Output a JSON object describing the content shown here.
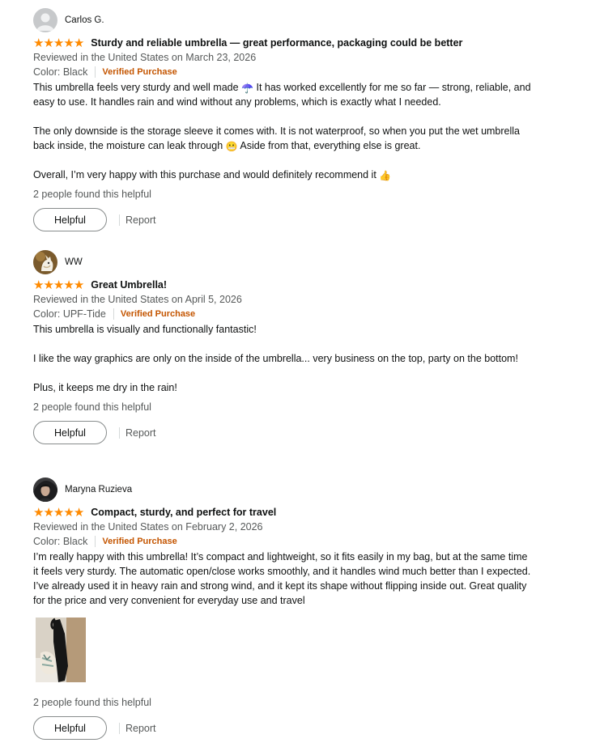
{
  "reviews": [
    {
      "author": "Carlos G.",
      "rating": 5,
      "title": "Sturdy and reliable umbrella — great performance, packaging could be better",
      "date": "Reviewed in the United States on March 23, 2026",
      "color": "Color: Black",
      "verified": "Verified Purchase",
      "p1": "This umbrella feels very sturdy and well made",
      "p1_emoji": "☂️",
      "p1_rest": " It has worked excellently for me so far — strong, reliable, and easy to use. It handles rain and wind without any problems, which is exactly what I needed.",
      "p2": "The only downside is the storage sleeve it comes with. It is not waterproof, so when you put the wet umbrella back inside, the moisture can leak through",
      "p2_emoji": "😬",
      "p2_rest": " Aside from that, everything else is great.",
      "p3": "Overall, I’m very happy with this purchase and would definitely recommend it",
      "p3_emoji": "👍",
      "helpful_count": "2 people found this helpful",
      "helpful_label": "Helpful",
      "report_label": "Report"
    },
    {
      "author": "WW",
      "rating": 5,
      "title": "Great Umbrella!",
      "date": "Reviewed in the United States on April 5, 2026",
      "color": "Color: UPF-Tide",
      "verified": "Verified Purchase",
      "p1": "This umbrella is visually and functionally fantastic!",
      "p2": "I like the way graphics are only on the inside of the umbrella... very business on the top, party on the bottom!",
      "p3": "Plus, it keeps me dry in the rain!",
      "helpful_count": "2 people found this helpful",
      "helpful_label": "Helpful",
      "report_label": "Report"
    },
    {
      "author": "Maryna Ruzieva",
      "rating": 5,
      "title": "Compact, sturdy, and perfect for travel",
      "date": "Reviewed in the United States on February 2, 2026",
      "color": "Color: Black",
      "verified": "Verified Purchase",
      "p1": "I’m really happy with this umbrella! It’s compact and lightweight, so it fits easily in my bag, but at the same time it feels very sturdy. The automatic open/close works smoothly, and it handles wind much better than I expected. I’ve already used it in heavy rain and strong wind, and it kept its shape without flipping inside out. Great quality for the price and very convenient for everyday use and travel",
      "helpful_count": "2 people found this helpful",
      "helpful_label": "Helpful",
      "report_label": "Report"
    }
  ],
  "colors": {
    "star": "#ff8a00",
    "verified": "#c45500",
    "muted": "#565959",
    "text": "#0f1111"
  },
  "icons": {
    "star": "star-icon",
    "default_avatar": "default-avatar-icon"
  }
}
